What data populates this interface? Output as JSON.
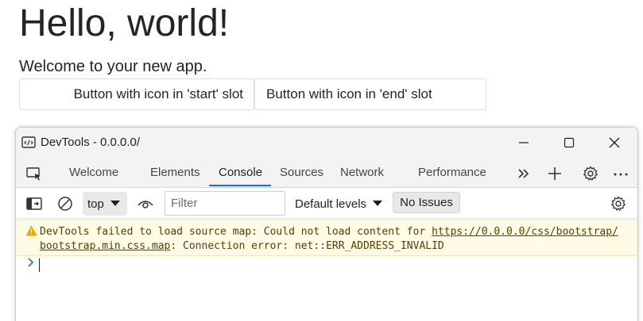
{
  "page": {
    "title": "Hello, world!",
    "subtitle": "Welcome to your new app.",
    "buttons": {
      "start_label": "Button with icon in 'start' slot",
      "end_label": "Button with icon in 'end' slot"
    }
  },
  "devtools": {
    "window_title": "DevTools - 0.0.0.0/",
    "tabs": [
      {
        "label": "Welcome"
      },
      {
        "label": "Elements"
      },
      {
        "label": "Console",
        "active": true
      },
      {
        "label": "Sources"
      },
      {
        "label": "Network"
      },
      {
        "label": "Performance"
      }
    ],
    "console": {
      "context": "top",
      "filter_placeholder": "Filter",
      "levels": "Default levels",
      "issues": "No Issues",
      "warning": {
        "prefix": "DevTools failed to load source map: Could not load content for ",
        "link": "https://0.0.0.0/css/bootstrap/bootstrap.min.css.map",
        "suffix": ": Connection error: net::ERR_ADDRESS_INVALID"
      }
    }
  },
  "colors": {
    "accent": "#1a73e8",
    "warning_bg": "#fffbe5",
    "warning_text": "#5c3c00",
    "warning_icon": "#e8a400"
  }
}
